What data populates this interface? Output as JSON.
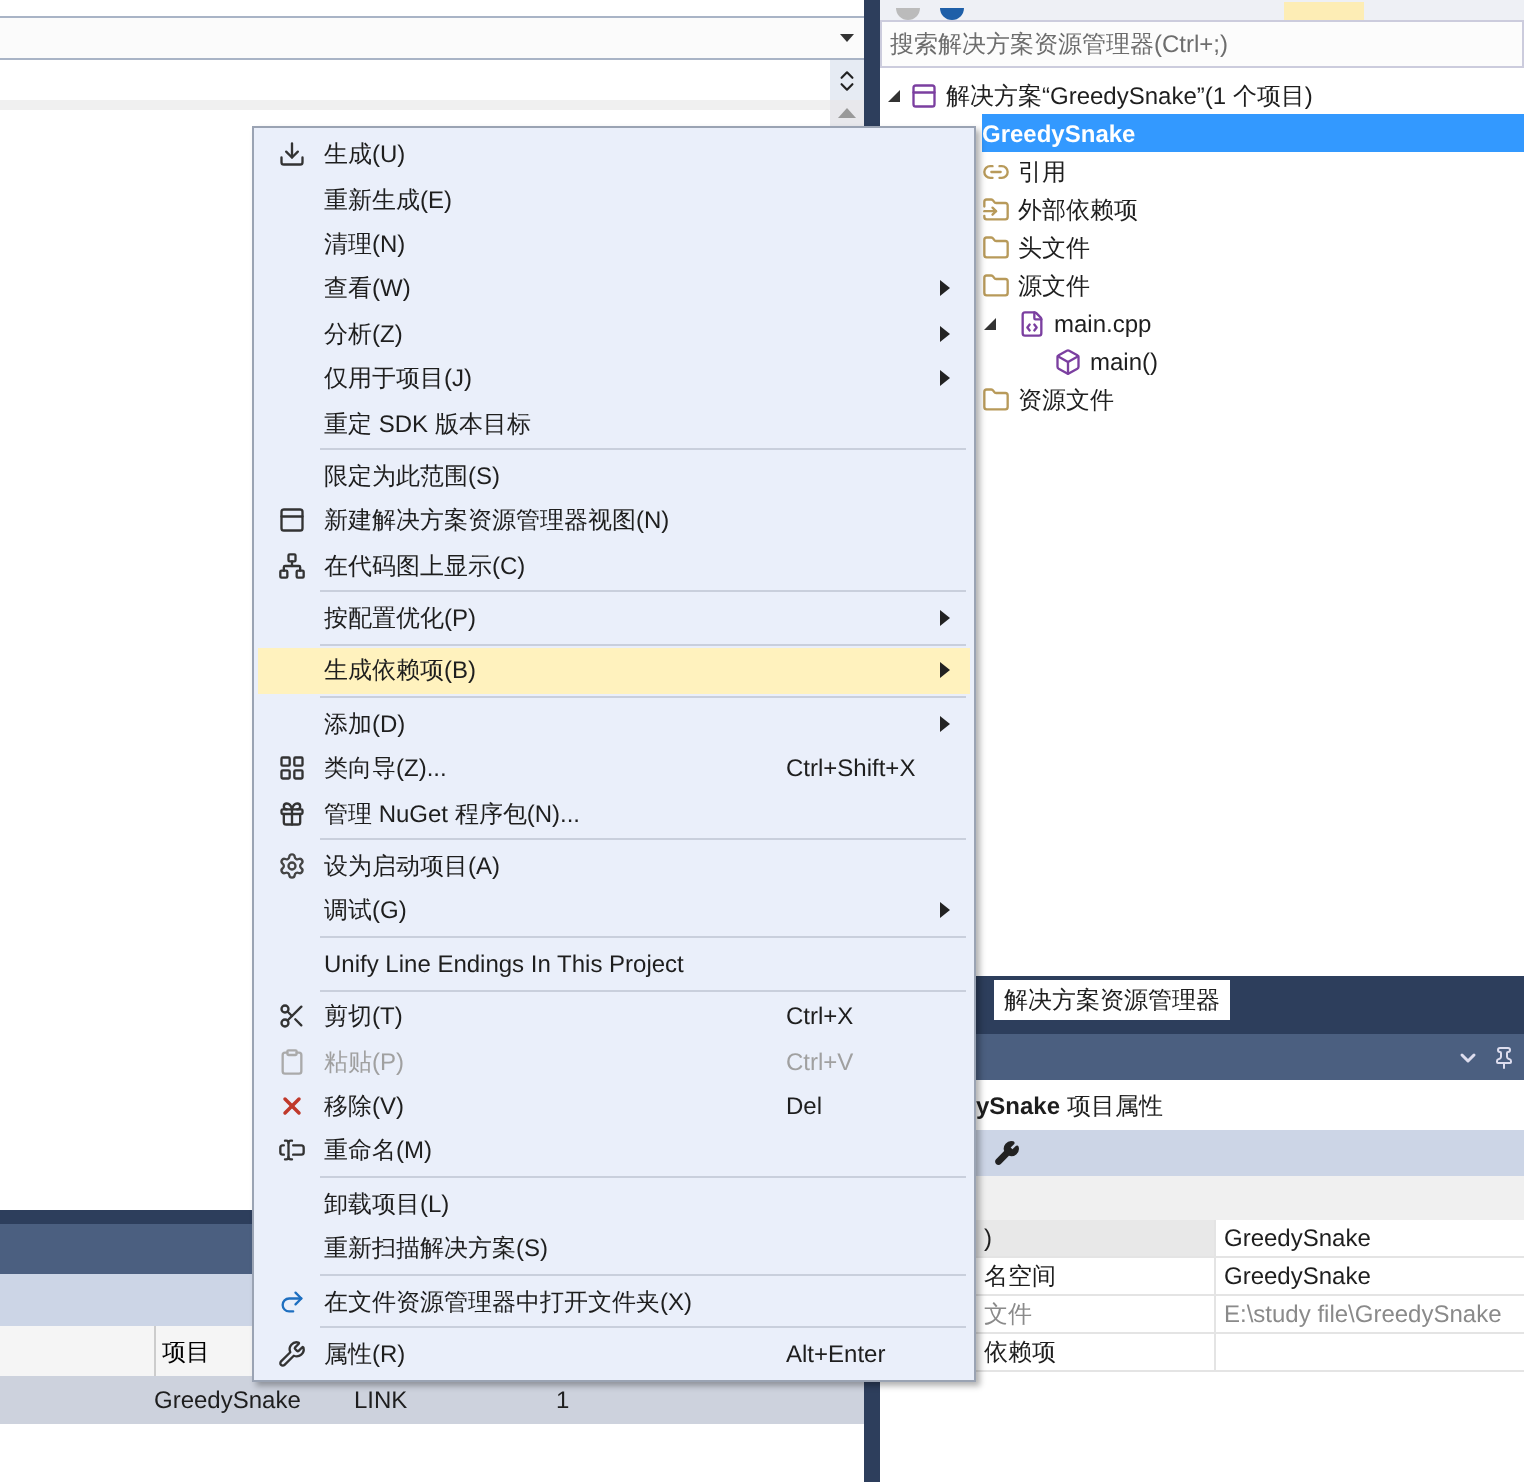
{
  "editor": {
    "output_panel": {
      "columns": [
        "项目"
      ],
      "rows": [
        {
          "cells": [
            "GreedySnake",
            "LINK",
            "1"
          ]
        }
      ]
    }
  },
  "solution_explorer": {
    "search": {
      "placeholder": "搜索解决方案资源管理器(Ctrl+;)"
    },
    "tree": [
      {
        "label": "解决方案“GreedySnake”(1 个项目)",
        "selected": false,
        "expanded": true,
        "children": [
          {
            "label": "GreedySnake",
            "selected": true,
            "children": [
              {
                "label": "引用",
                "selected": false
              },
              {
                "label": "外部依赖项",
                "selected": false
              },
              {
                "label": "头文件",
                "selected": false
              },
              {
                "label": "源文件",
                "selected": false,
                "children": [
                  {
                    "label": "main.cpp",
                    "selected": false,
                    "expanded": true,
                    "children": [
                      {
                        "label": "main()",
                        "selected": false
                      }
                    ]
                  }
                ]
              },
              {
                "label": "资源文件",
                "selected": false
              }
            ]
          }
        ]
      }
    ]
  },
  "tabs": [
    {
      "label": "解决方案资源管理器",
      "selected": true
    }
  ],
  "properties": {
    "title": "**ySnake** 项目属性",
    "rows": [
      {
        "name": ")",
        "value": "GreedySnake",
        "disabled": false
      },
      {
        "name": "名空间",
        "value": "GreedySnake",
        "disabled": false
      },
      {
        "name": "文件",
        "value": "E:\\study file\\GreedySnake",
        "disabled": true
      },
      {
        "name": "依赖项",
        "disabled": false
      }
    ]
  },
  "context_menu": {
    "items": [
      {
        "kind": "item",
        "label": "生成(U)",
        "submenu": false,
        "selected": false,
        "disabled": false
      },
      {
        "kind": "item",
        "label": "重新生成(E)",
        "submenu": false,
        "selected": false,
        "disabled": false
      },
      {
        "kind": "item",
        "label": "清理(N)",
        "submenu": false,
        "selected": false,
        "disabled": false
      },
      {
        "kind": "item",
        "label": "查看(W)",
        "submenu": true,
        "selected": false,
        "disabled": false
      },
      {
        "kind": "item",
        "label": "分析(Z)",
        "submenu": true,
        "selected": false,
        "disabled": false
      },
      {
        "kind": "item",
        "label": "仅用于项目(J)",
        "submenu": true,
        "selected": false,
        "disabled": false
      },
      {
        "kind": "item",
        "label": "重定 SDK 版本目标",
        "submenu": false,
        "selected": false,
        "disabled": false
      },
      {
        "kind": "separator"
      },
      {
        "kind": "item",
        "label": "限定为此范围(S)",
        "submenu": false,
        "selected": false,
        "disabled": false
      },
      {
        "kind": "item",
        "label": "新建解决方案资源管理器视图(N)",
        "submenu": false,
        "selected": false,
        "disabled": false
      },
      {
        "kind": "item",
        "label": "在代码图上显示(C)",
        "submenu": false,
        "selected": false,
        "disabled": false
      },
      {
        "kind": "separator"
      },
      {
        "kind": "item",
        "label": "按配置优化(P)",
        "submenu": true,
        "selected": false,
        "disabled": false
      },
      {
        "kind": "separator"
      },
      {
        "kind": "item",
        "label": "生成依赖项(B)",
        "submenu": true,
        "selected": true,
        "disabled": false
      },
      {
        "kind": "separator"
      },
      {
        "kind": "item",
        "label": "添加(D)",
        "submenu": true,
        "selected": false,
        "disabled": false
      },
      {
        "kind": "item",
        "label": "类向导(Z)...",
        "shortcut": "Ctrl+Shift+X",
        "submenu": false,
        "selected": false,
        "disabled": false
      },
      {
        "kind": "item",
        "label": "管理 NuGet 程序包(N)...",
        "submenu": false,
        "selected": false,
        "disabled": false
      },
      {
        "kind": "separator"
      },
      {
        "kind": "item",
        "label": "设为启动项目(A)",
        "submenu": false,
        "selected": false,
        "disabled": false
      },
      {
        "kind": "item",
        "label": "调试(G)",
        "submenu": true,
        "selected": false,
        "disabled": false
      },
      {
        "kind": "separator"
      },
      {
        "kind": "item",
        "label": "Unify Line Endings In This Project",
        "submenu": false,
        "selected": false,
        "disabled": false
      },
      {
        "kind": "separator"
      },
      {
        "kind": "item",
        "label": "剪切(T)",
        "shortcut": "Ctrl+X",
        "submenu": false,
        "selected": false,
        "disabled": false
      },
      {
        "kind": "item",
        "label": "粘贴(P)",
        "shortcut": "Ctrl+V",
        "submenu": false,
        "selected": false,
        "disabled": true
      },
      {
        "kind": "item",
        "label": "移除(V)",
        "shortcut": "Del",
        "submenu": false,
        "selected": false,
        "disabled": false
      },
      {
        "kind": "item",
        "label": "重命名(M)",
        "submenu": false,
        "selected": false,
        "disabled": false
      },
      {
        "kind": "separator"
      },
      {
        "kind": "item",
        "label": "卸载项目(L)",
        "submenu": false,
        "selected": false,
        "disabled": false
      },
      {
        "kind": "item",
        "label": "重新扫描解决方案(S)",
        "submenu": false,
        "selected": false,
        "disabled": false
      },
      {
        "kind": "separator"
      },
      {
        "kind": "item",
        "label": "在文件资源管理器中打开文件夹(X)",
        "submenu": false,
        "selected": false,
        "disabled": false
      },
      {
        "kind": "separator"
      },
      {
        "kind": "item",
        "label": "属性(R)",
        "shortcut": "Alt+Enter",
        "submenu": false,
        "selected": false,
        "disabled": false
      }
    ]
  }
}
